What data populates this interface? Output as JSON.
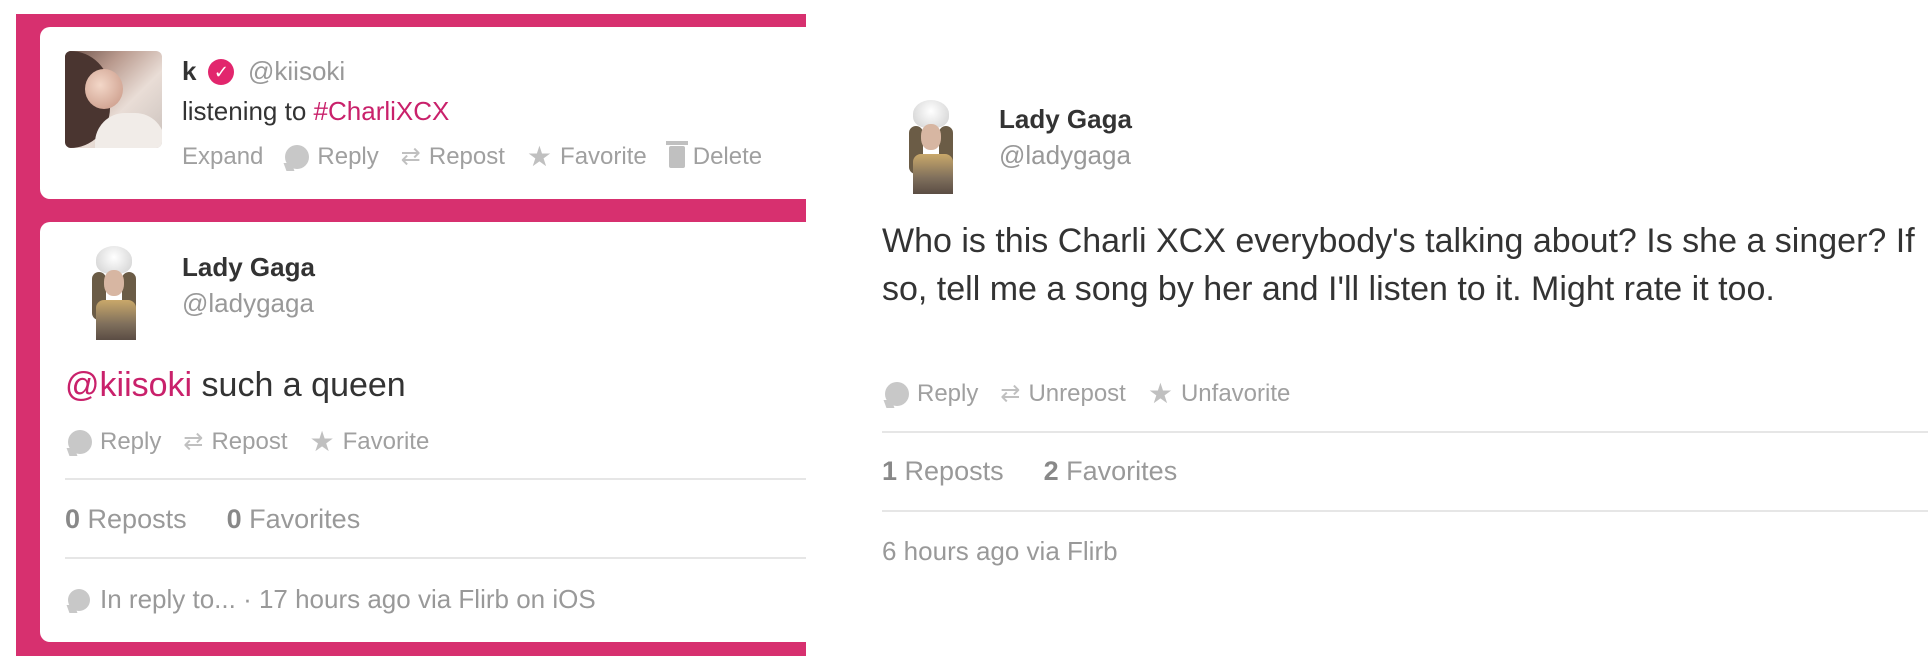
{
  "left_panel": {
    "top_tweet": {
      "name": "k",
      "handle": "@kiisoki",
      "text_prefix": "listening to ",
      "hashtag": "#CharliXCX",
      "actions": [
        "Expand",
        "Reply",
        "Repost",
        "Favorite",
        "Delete"
      ]
    },
    "main_tweet": {
      "name": "Lady Gaga",
      "handle": "@ladygaga",
      "mention": "@kiisoki",
      "text": " such a queen",
      "actions": [
        "Reply",
        "Repost",
        "Favorite"
      ],
      "reposts_count": "0",
      "reposts_label": "Reposts",
      "favorites_count": "0",
      "favorites_label": "Favorites",
      "footer": "In reply to... · 17 hours ago via Flirb on iOS"
    }
  },
  "right_panel": {
    "name": "Lady Gaga",
    "handle": "@ladygaga",
    "text": "Who is this Charli XCX everybody's talking about? Is she a singer? If so, tell me a song by her and I'll listen to it. Might rate it too.",
    "actions": [
      "Reply",
      "Unrepost",
      "Unfavorite"
    ],
    "reposts_count": "1",
    "reposts_label": "Reposts",
    "favorites_count": "2",
    "favorites_label": "Favorites",
    "footer": "6 hours ago via Flirb"
  },
  "colors": {
    "accent": "#d7306f",
    "link": "#c9216b",
    "muted": "#999999"
  }
}
